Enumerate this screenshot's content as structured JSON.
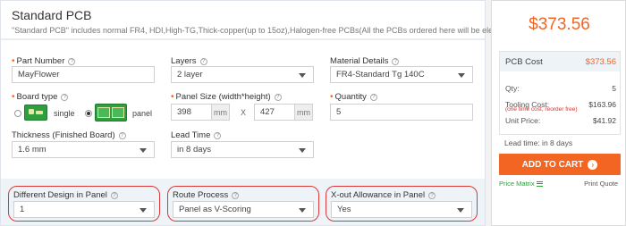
{
  "form": {
    "title": "Standard PCB",
    "description": "\"Standard PCB\" includes normal FR4, HDI,High-TG,Thick-copper(up to 15oz),Halogen-free PCBs(All the PCBs ordered here will be electrically tested)",
    "part_number": {
      "label": "Part Number",
      "value": "MayFlower"
    },
    "layers": {
      "label": "Layers",
      "value": "2 layer"
    },
    "material": {
      "label": "Material Details",
      "value": "FR4-Standard Tg 140C"
    },
    "board_type": {
      "label": "Board type",
      "option_single": "single",
      "option_panel": "panel",
      "selected": "panel"
    },
    "panel_size": {
      "label": "Panel Size (width*height)",
      "width": "398",
      "height": "427",
      "unit": "mm",
      "separator": "X"
    },
    "quantity": {
      "label": "Quantity",
      "value": "5"
    },
    "thickness": {
      "label": "Thickness (Finished Board)",
      "value": "1.6 mm"
    },
    "lead_time": {
      "label": "Lead Time",
      "value": "in 8 days"
    },
    "different_design": {
      "label": "Different Design in Panel",
      "value": "1"
    },
    "route_process": {
      "label": "Route Process",
      "value": "Panel as V-Scoring"
    },
    "xout": {
      "label": "X-out Allowance in Panel",
      "value": "Yes"
    },
    "help_glyph": "?",
    "required_glyph": "•"
  },
  "summary": {
    "total": "$373.56",
    "pcb_cost_label": "PCB Cost",
    "pcb_cost_value": "$373.56",
    "qty_label": "Qty:",
    "qty_value": "5",
    "tooling_label": "Tooling Cost:",
    "tooling_value": "$163.96",
    "tooling_note": "(one time cost, reorder free)",
    "unit_price_label": "Unit Price:",
    "unit_price_value": "$41.92",
    "lead_time": "Lead time: in 8 days",
    "cart_button": "ADD TO CART",
    "cart_arrow": "›",
    "price_matrix": "Price Matrix",
    "print_quote": "Print Quote"
  },
  "colors": {
    "accent": "#f26522",
    "highlight_outline": "#d83a3a",
    "link_green": "#2e9e3e"
  }
}
